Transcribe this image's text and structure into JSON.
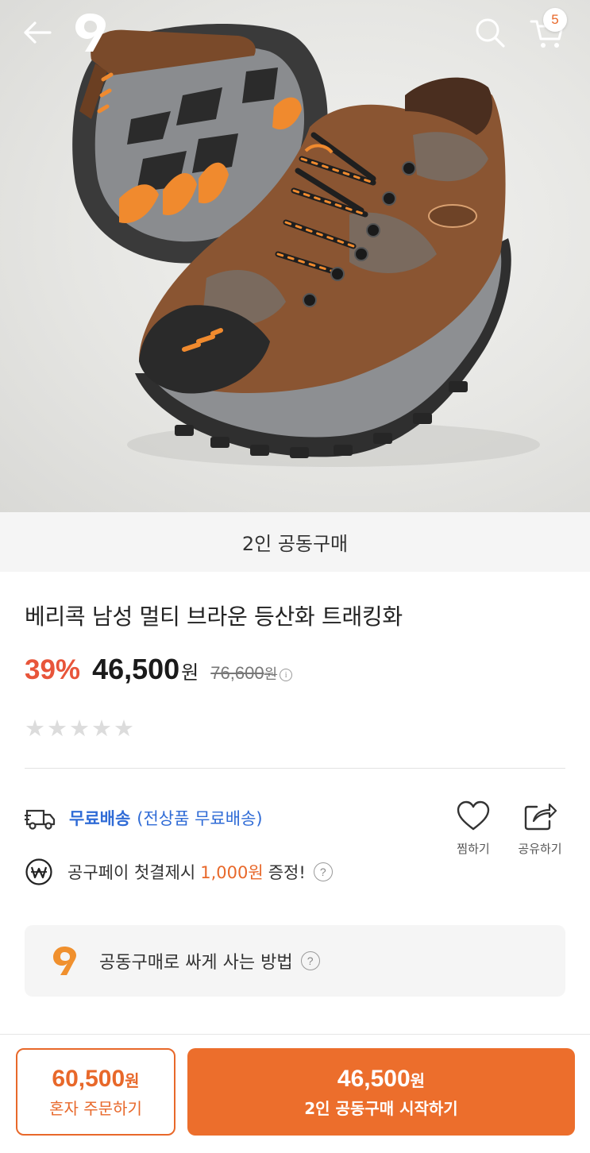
{
  "header": {
    "cart_count": "5"
  },
  "hero": {
    "banner_text": "2인 공동구매",
    "image_desc": "brown hiking shoes with orange laces and black rubber soles"
  },
  "product": {
    "title": "베리콕 남성 멀티 브라운 등산화 트래킹화",
    "discount": "39%",
    "price": "46,500",
    "price_unit": "원",
    "original_price": "76,600",
    "original_unit": "원",
    "info_icon": "i",
    "rating_stars": 0,
    "rating_max": 5
  },
  "shipping": {
    "label": "무료배송",
    "sub": "(전상품 무료배송)"
  },
  "pay": {
    "pre": "공구페이 첫결제시",
    "amount": "1,000원",
    "post": "증정!",
    "help": "?"
  },
  "actions": {
    "wish_label": "찜하기",
    "share_label": "공유하기"
  },
  "howto": {
    "text": "공동구매로 싸게 사는 방법",
    "help": "?"
  },
  "bottom": {
    "solo_price": "60,500",
    "solo_unit": "원",
    "solo_label": "혼자 주문하기",
    "group_price": "46,500",
    "group_unit": "원",
    "group_label": "2인 공동구매 시작하기"
  },
  "colors": {
    "accent": "#ec6e2c",
    "discount": "#e8553a",
    "link_blue": "#2f6bd6"
  }
}
